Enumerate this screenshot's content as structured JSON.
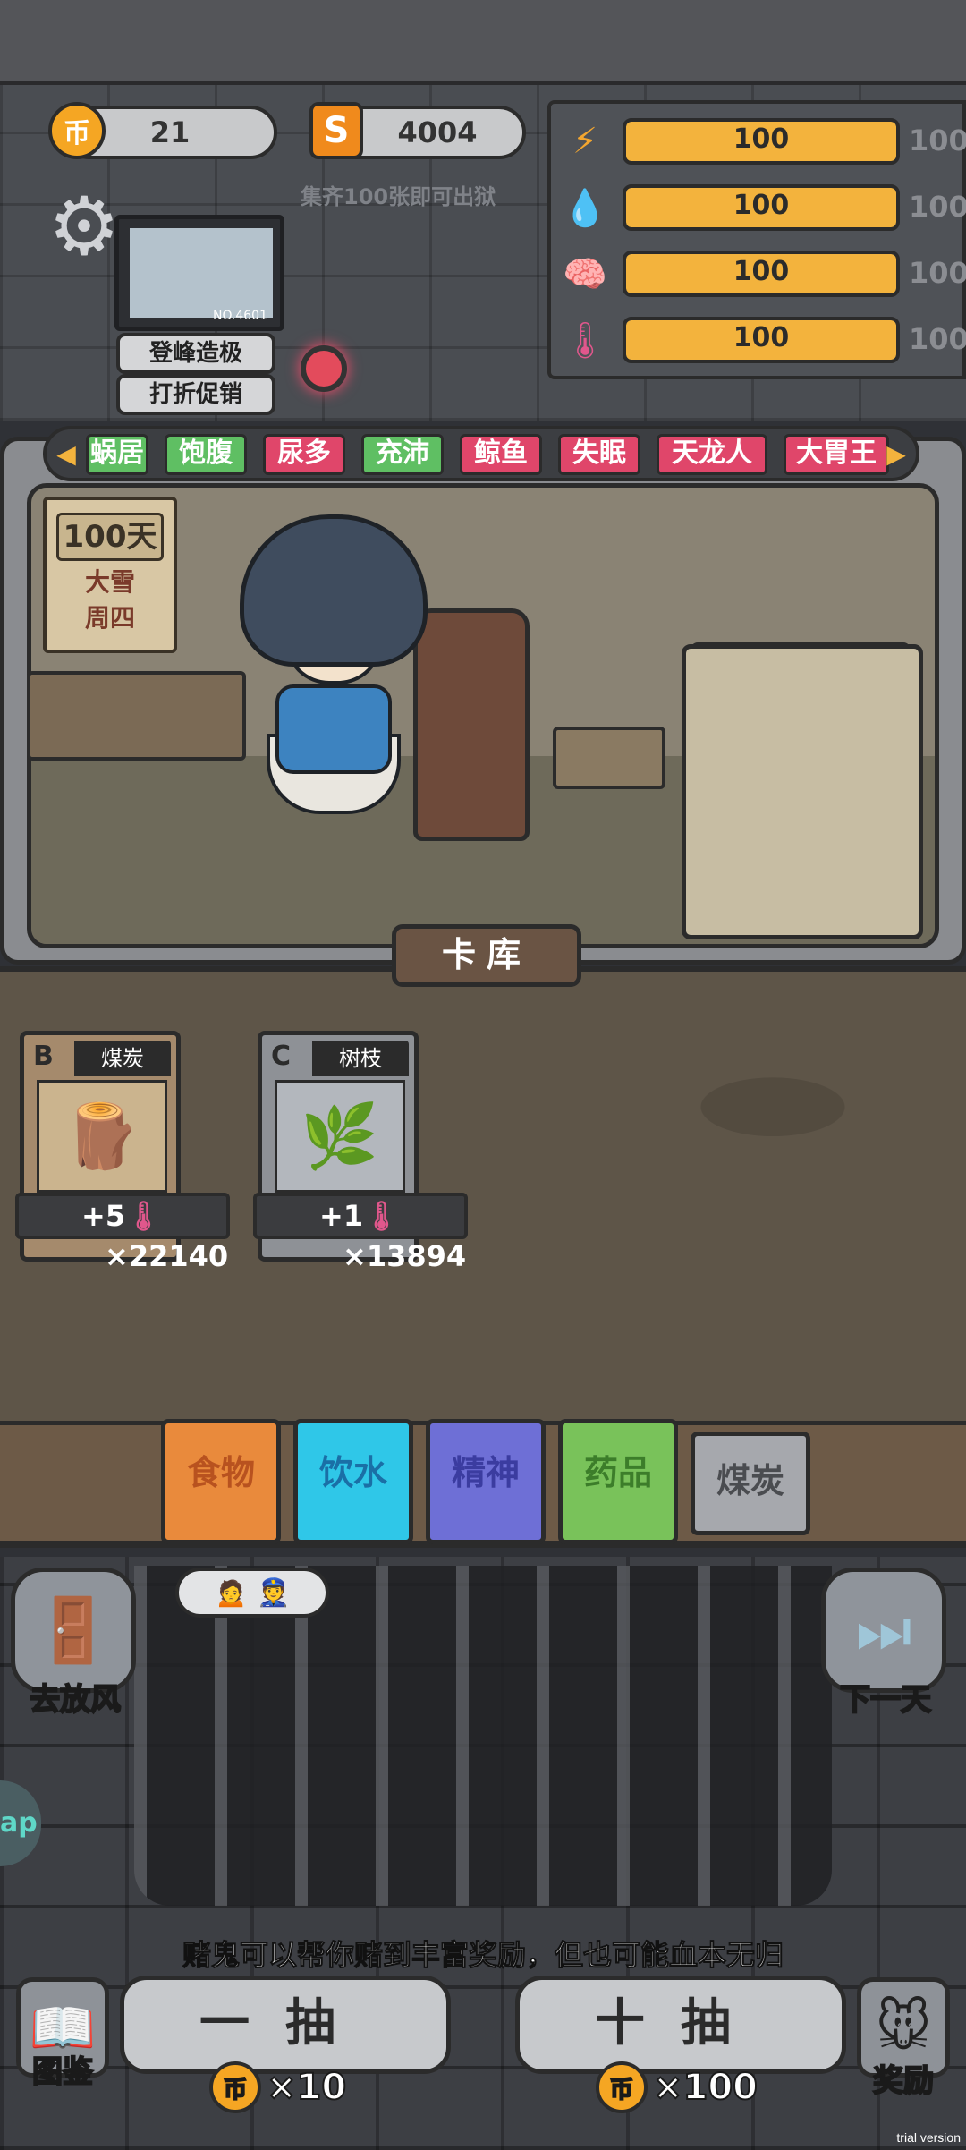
{
  "currency": {
    "coins": "21",
    "s_points": "4004",
    "coin_glyph": "币",
    "s_glyph": "S",
    "hint": "集齐100张即可出狱"
  },
  "stats": [
    {
      "name": "energy",
      "icon": "lightning-icon",
      "glyph": "⚡",
      "value": "100",
      "max": "100",
      "fill": 1.0
    },
    {
      "name": "water",
      "icon": "water-drop-icon",
      "glyph": "💧",
      "value": "100",
      "max": "100",
      "fill": 1.0
    },
    {
      "name": "mind",
      "icon": "brain-icon",
      "glyph": "🧠",
      "value": "100",
      "max": "100",
      "fill": 1.0
    },
    {
      "name": "temperature",
      "icon": "thermometer-icon",
      "glyph": "🌡",
      "value": "100",
      "max": "100",
      "fill": 1.0
    }
  ],
  "portrait": {
    "number": "NO.4601"
  },
  "buttons": {
    "peak": "登峰造极",
    "discount": "打折促销"
  },
  "tags": [
    {
      "label": "蜗居",
      "color": "#5fbf63"
    },
    {
      "label": "饱腹",
      "color": "#5fbf63"
    },
    {
      "label": "尿多",
      "color": "#e0466a"
    },
    {
      "label": "充沛",
      "color": "#5fbf63"
    },
    {
      "label": "鲸鱼",
      "color": "#e0466a"
    },
    {
      "label": "失眠",
      "color": "#e0466a"
    },
    {
      "label": "天龙人",
      "color": "#e0466a"
    },
    {
      "label": "大胃王",
      "color": "#e0466a"
    }
  ],
  "calendar": {
    "day": "100天",
    "weather": "大雪",
    "weekday": "周四"
  },
  "section_title": "卡库",
  "cards": [
    {
      "grade": "B",
      "name": "煤炭",
      "effect": "+5",
      "count": "×22140",
      "bg": "#a58a6c",
      "img_bg": "#cbb48e",
      "img": "🪵"
    },
    {
      "grade": "C",
      "name": "树枝",
      "effect": "+1",
      "count": "×13894",
      "bg": "#8e9196",
      "img_bg": "#b3b7bd",
      "img": "🌿"
    }
  ],
  "categories": [
    {
      "label": "食物",
      "bg": "#e98a3c",
      "color": "#b8521f"
    },
    {
      "label": "饮水",
      "bg": "#2fc7e8",
      "color": "#1a6fa6"
    },
    {
      "label": "精神",
      "bg": "#6e6fd6",
      "color": "#3b3ca0"
    },
    {
      "label": "药品",
      "bg": "#79c25a",
      "color": "#3c7d2a"
    },
    {
      "label": "煤炭",
      "bg": "#a6a8ad",
      "color": "#4a4c50"
    }
  ],
  "side": {
    "left": "去放风",
    "right": "下一天"
  },
  "app_tab": "ap",
  "tip": "赌鬼可以帮你赌到丰富奖励，但也可能血本无归",
  "draw": {
    "single": "一抽",
    "single_cost": "×10",
    "ten": "十抽",
    "ten_cost": "×100"
  },
  "bottom": {
    "book": "图鉴",
    "reward": "奖励"
  },
  "watermark": "trial version"
}
